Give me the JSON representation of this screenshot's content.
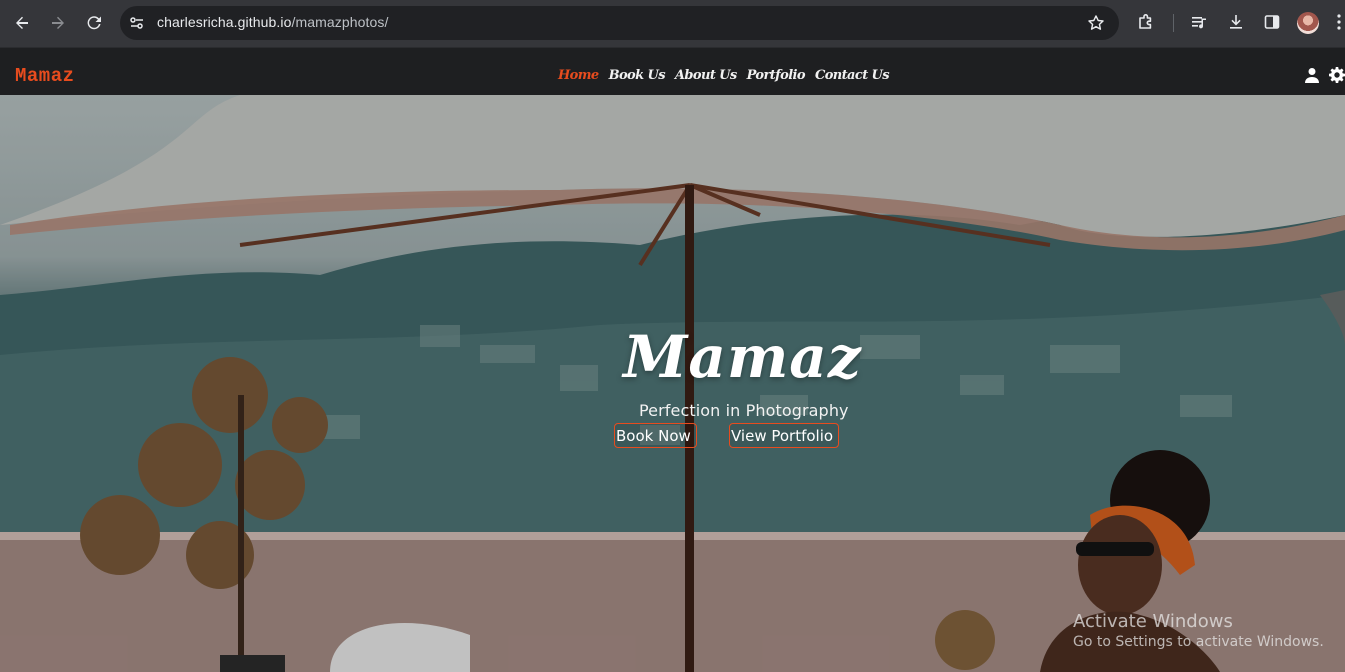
{
  "browser": {
    "url_host": "charlesricha.github.io",
    "url_path": "/mamazphotos/",
    "icons": {
      "back": "arrow-left-icon",
      "forward": "arrow-right-icon",
      "reload": "reload-icon",
      "site_info": "tune-icon",
      "bookmark": "star-icon",
      "extensions": "puzzle-icon",
      "media": "media-queue-icon",
      "downloads": "download-icon",
      "side_panel": "side-panel-icon",
      "profile": "profile-avatar",
      "menu": "kebab-icon"
    }
  },
  "site": {
    "brand": "Mamaz",
    "nav": [
      {
        "label": "Home",
        "active": true
      },
      {
        "label": "Book Us",
        "active": false
      },
      {
        "label": "About Us",
        "active": false
      },
      {
        "label": "Portfolio",
        "active": false
      },
      {
        "label": "Contact Us",
        "active": false
      }
    ],
    "accent_color": "#e84c1e",
    "icons": {
      "user": "user-icon",
      "settings": "gear-icon"
    }
  },
  "hero": {
    "title": "Mamaz",
    "tagline": "Perfection in Photography",
    "buttons": {
      "book": "Book Now",
      "portfolio": "View Portfolio"
    }
  },
  "os_watermark": {
    "title": "Activate Windows",
    "subtitle": "Go to Settings to activate Windows."
  }
}
